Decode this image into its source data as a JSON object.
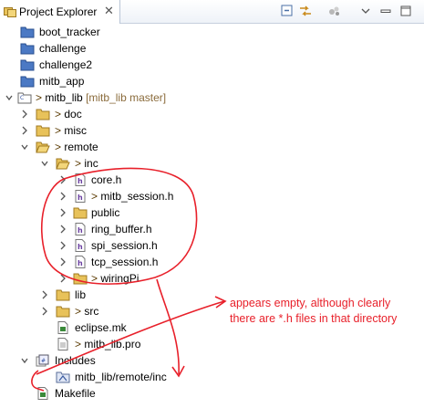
{
  "view": {
    "title": "Project Explorer",
    "close": "✕"
  },
  "tree": {
    "boot_tracker": "boot_tracker",
    "challenge": "challenge",
    "challenge2": "challenge2",
    "mitb_app": "mitb_app",
    "mitb_lib": "mitb_lib",
    "mitb_lib_branch": "[mitb_lib master]",
    "doc": "doc",
    "misc": "misc",
    "remote": "remote",
    "inc": "inc",
    "core_h": "core.h",
    "mitb_session_h": "mitb_session.h",
    "public": "public",
    "ring_buffer_h": "ring_buffer.h",
    "spi_session_h": "spi_session.h",
    "tcp_session_h": "tcp_session.h",
    "wiringPi": "wiringPi",
    "lib": "lib",
    "src": "src",
    "eclipse_mk": "eclipse.mk",
    "mitb_lib_pro": "mitb_lib.pro",
    "includes": "Includes",
    "include_path": "mitb_lib/remote/inc",
    "makefile": "Makefile",
    "dirty_marker": ">"
  },
  "annotation": {
    "text": "appears empty, although clearly there are *.h files in that directory",
    "color": "#e8202a"
  }
}
